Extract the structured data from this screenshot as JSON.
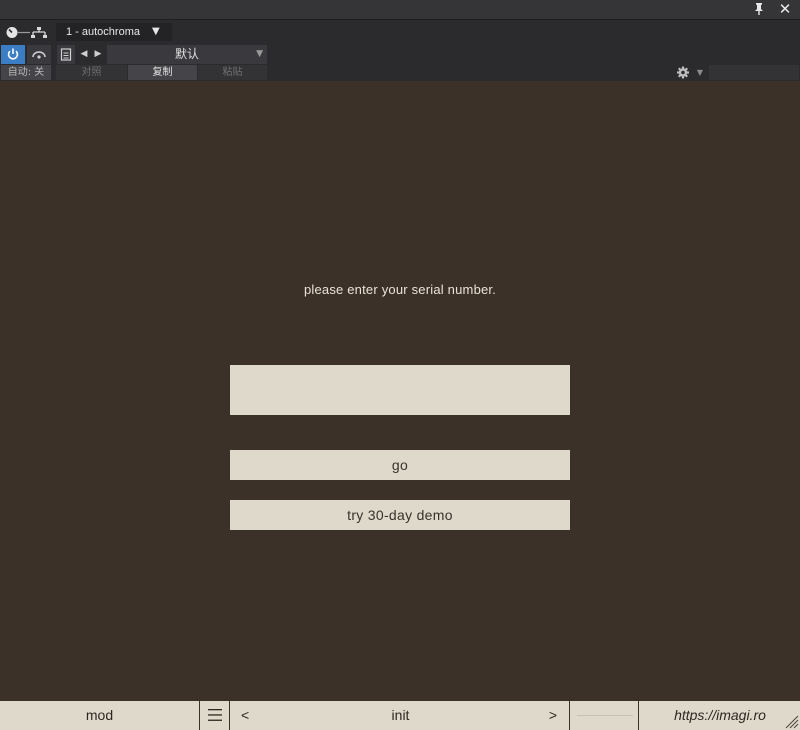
{
  "host": {
    "track_instance": "1 - autochroma",
    "preset_name": "默认",
    "auto_label": "自动: 关",
    "compare_label": "对照",
    "copy_label": "复制",
    "paste_label": "粘贴",
    "accent_color": "#3b7ec6",
    "icons": [
      "pin-icon",
      "close-icon",
      "knob-icon",
      "routing-icon",
      "power-icon",
      "bypass-icon",
      "document-icon",
      "gear-icon"
    ]
  },
  "plugin": {
    "background_color": "#3c3129",
    "panel_color": "#dfd9cc",
    "prompt": "please enter your serial number.",
    "serial_value": "",
    "go_label": "go",
    "demo_label": "try 30-day demo"
  },
  "footer": {
    "mod_label": "mod",
    "prev_label": "<",
    "preset_label": "init",
    "next_label": ">",
    "url": "https://imagi.ro"
  }
}
